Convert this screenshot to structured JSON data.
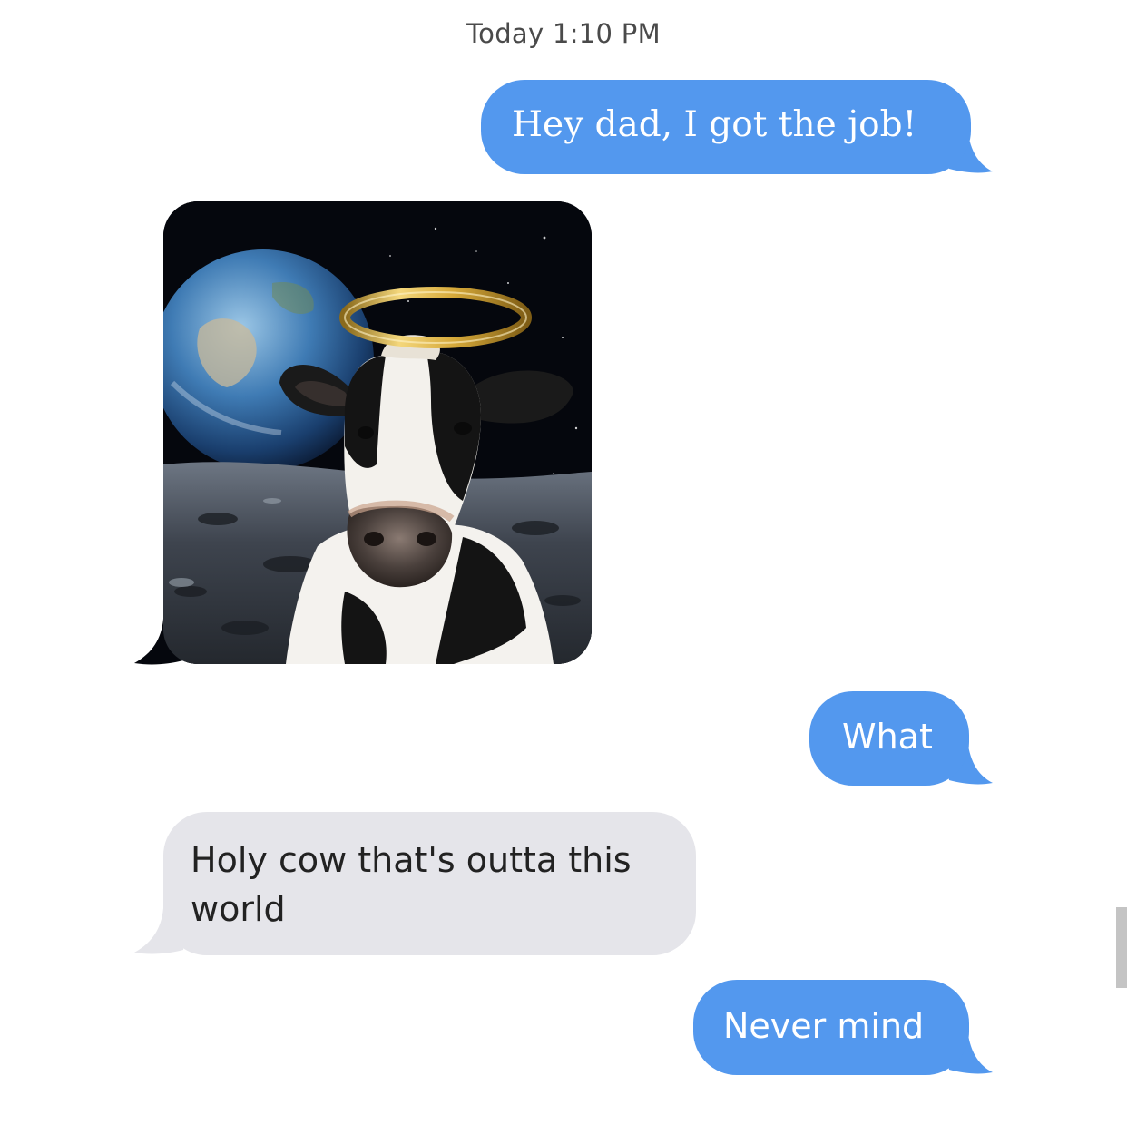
{
  "conversation": {
    "timestamp": "Today 1:10 PM",
    "messages": [
      {
        "direction": "sent",
        "type": "text",
        "text": "Hey dad, I got the job!"
      },
      {
        "direction": "received",
        "type": "image",
        "image_content": "cow with halo on the moon with Earth in background"
      },
      {
        "direction": "sent",
        "type": "text",
        "text": "What"
      },
      {
        "direction": "received",
        "type": "text",
        "text": "Holy cow that's outta this world"
      },
      {
        "direction": "sent",
        "type": "text",
        "text": "Never mind"
      }
    ]
  },
  "colors": {
    "sent_bubble": "#5398ee",
    "received_bubble": "#e5e5ea",
    "background": "#ffffff"
  }
}
